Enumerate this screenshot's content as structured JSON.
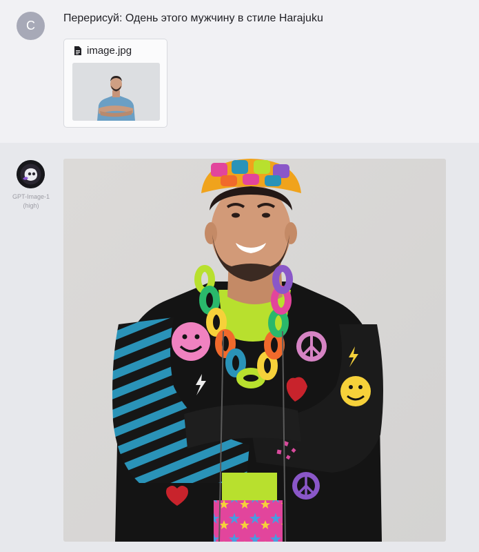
{
  "user_message": {
    "avatar_initial": "C",
    "text": "Перерисуй: Одень этого мужчину в стиле Harajuku",
    "attachment": {
      "filename": "image.jpg",
      "icon": "document-icon"
    }
  },
  "bot_message": {
    "model_name": "GPT-Image-1",
    "model_quality": "(high)",
    "avatar_icon": "robot-avatar-icon"
  },
  "colors": {
    "user_row_bg": "#f1f1f4",
    "bot_row_bg": "#e7e8ec",
    "avatar_user_bg": "#a7a9b7"
  }
}
